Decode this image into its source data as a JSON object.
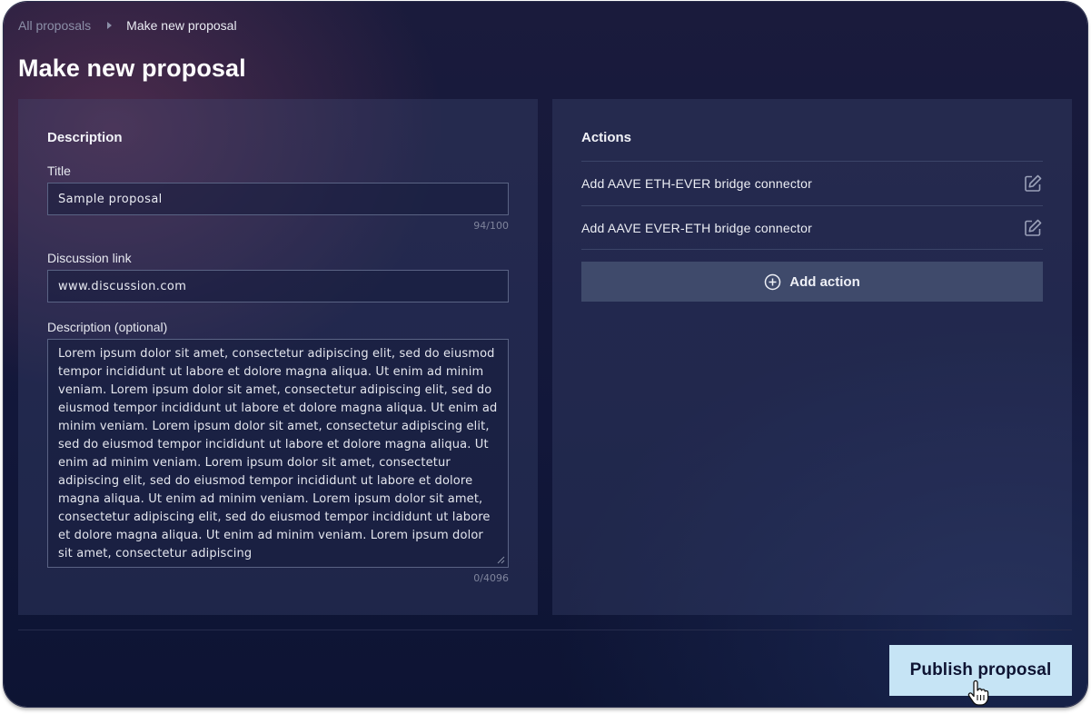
{
  "breadcrumb": {
    "parent": "All proposals",
    "current": "Make new proposal"
  },
  "page": {
    "title": "Make new proposal"
  },
  "description_section": {
    "heading": "Description",
    "title_label": "Title",
    "title_value": "Sample proposal",
    "title_counter": "94/100",
    "link_label": "Discussion link",
    "link_value": "www.discussion.com",
    "desc_label": "Description (optional)",
    "desc_value": "Lorem ipsum dolor sit amet, consectetur adipiscing elit, sed do eiusmod tempor incididunt ut labore et dolore magna aliqua. Ut enim ad minim veniam. Lorem ipsum dolor sit amet, consectetur adipiscing elit, sed do eiusmod tempor incididunt ut labore et dolore magna aliqua. Ut enim ad minim veniam. Lorem ipsum dolor sit amet, consectetur adipiscing elit, sed do eiusmod tempor incididunt ut labore et dolore magna aliqua. Ut enim ad minim veniam. Lorem ipsum dolor sit amet, consectetur adipiscing elit, sed do eiusmod tempor incididunt ut labore et dolore magna aliqua. Ut enim ad minim veniam. Lorem ipsum dolor sit amet, consectetur adipiscing elit, sed do eiusmod tempor incididunt ut labore et dolore magna aliqua. Ut enim ad minim veniam. Lorem ipsum dolor sit amet, consectetur adipiscing",
    "desc_counter": "0/4096"
  },
  "actions_section": {
    "heading": "Actions",
    "items": [
      {
        "label": "Add AAVE ETH-EVER bridge connector",
        "icon": "edit-icon"
      },
      {
        "label": "Add AAVE EVER-ETH bridge connector",
        "icon": "edit-icon"
      }
    ],
    "add_label": "Add action",
    "add_icon": "plus-circle-icon"
  },
  "footer": {
    "publish_label": "Publish proposal",
    "cursor_icon": "hand-pointer-icon"
  },
  "colors": {
    "publish_bg": "#c6e4f5",
    "panel_bg": "#2a3357",
    "add_action_bg": "#3f4a6b"
  }
}
